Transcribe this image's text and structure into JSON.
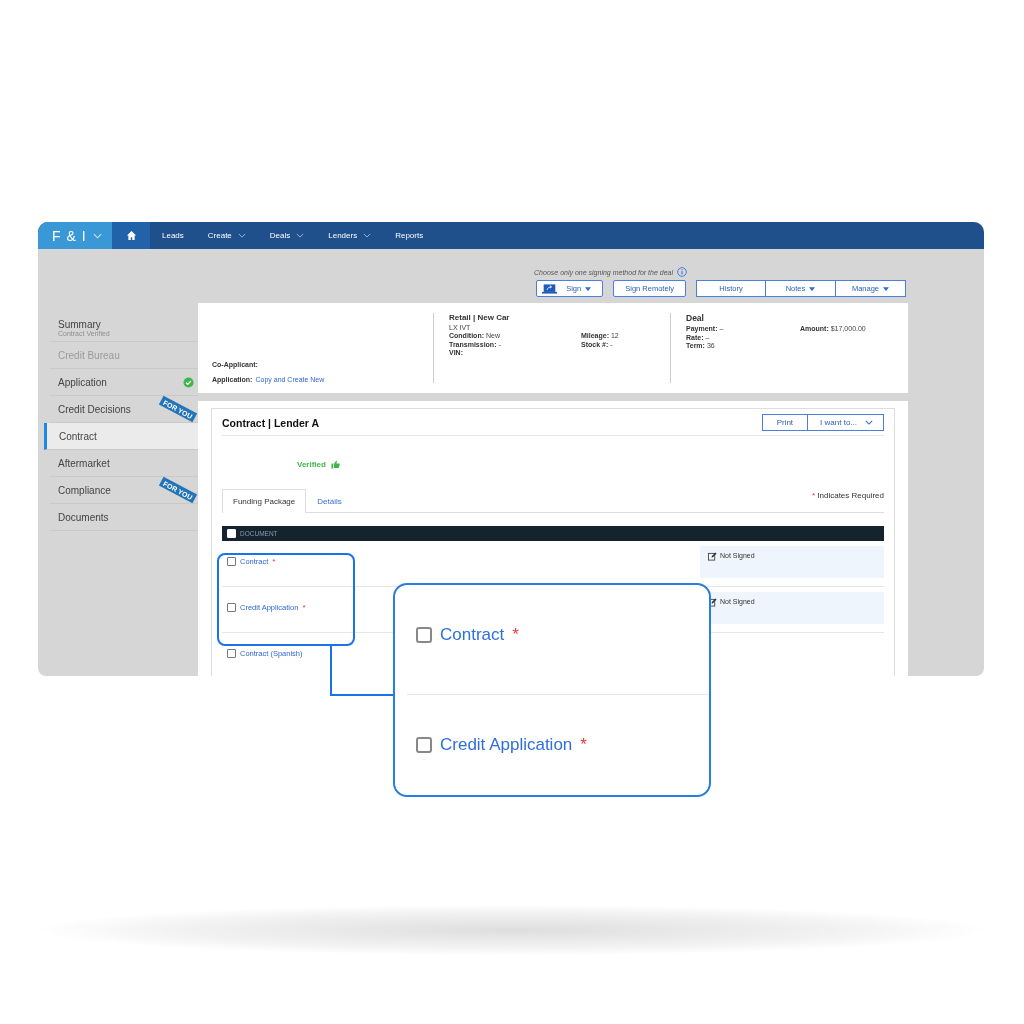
{
  "nav": {
    "brand": "F & I",
    "items": [
      {
        "label": "Leads",
        "dropdown": false
      },
      {
        "label": "Create",
        "dropdown": true
      },
      {
        "label": "Deals",
        "dropdown": true
      },
      {
        "label": "Lenders",
        "dropdown": true
      },
      {
        "label": "Reports",
        "dropdown": false
      }
    ]
  },
  "sidebar": {
    "items": [
      {
        "label": "Summary",
        "subtitle": "Contract Verified",
        "disabled": false,
        "done": false,
        "selected": false
      },
      {
        "label": "Credit Bureau",
        "disabled": true,
        "done": false,
        "selected": false
      },
      {
        "label": "Application",
        "disabled": false,
        "done": true,
        "selected": false
      },
      {
        "label": "Credit Decisions",
        "disabled": false,
        "done": false,
        "selected": false,
        "badge": "FOR YOU",
        "children": [
          {
            "label": "Contract",
            "disabled": false,
            "done": false,
            "selected": true
          }
        ]
      },
      {
        "label": "Aftermarket",
        "disabled": false,
        "done": false,
        "selected": false
      },
      {
        "label": "Compliance",
        "disabled": false,
        "done": false,
        "selected": false,
        "badge": "FOR YOU"
      },
      {
        "label": "Documents",
        "disabled": false,
        "done": false,
        "selected": false
      }
    ]
  },
  "signing": {
    "note": "Choose only one signing method for the deal",
    "sign_button": "Sign",
    "remote_button": "Sign Remotely",
    "menu_buttons": [
      {
        "label": "History",
        "dropdown": false
      },
      {
        "label": "Notes",
        "dropdown": true
      },
      {
        "label": "Manage",
        "dropdown": true
      }
    ]
  },
  "summary": {
    "co_applicant": "Co-Applicant:",
    "application_label": "Application:",
    "application_link": "Copy and Create New",
    "vehicle": {
      "title": "Retail | New Car",
      "model": "LX IVT",
      "fields": [
        {
          "label": "Condition:",
          "value": "New"
        },
        {
          "label": "Mileage:",
          "value": "12"
        },
        {
          "label": "Transmission:",
          "value": "-"
        },
        {
          "label": "Stock #:",
          "value": "-"
        },
        {
          "label": "VIN:"
        }
      ]
    },
    "deal": {
      "title": "Deal",
      "fields": [
        {
          "label": "Payment:",
          "value": "–"
        },
        {
          "label": "Amount:",
          "value": "$17,000.00"
        },
        {
          "label": "Rate:",
          "value": "–"
        },
        {
          "label": "Term:",
          "value": "36"
        }
      ]
    }
  },
  "contract": {
    "title": "Contract | Lender A",
    "print_button": "Print",
    "menu_button": "I want to...",
    "status": "Verified",
    "tabs": [
      {
        "label": "Funding Package",
        "selected": true
      },
      {
        "label": "Details",
        "selected": false
      }
    ],
    "required_note": "Indicates Required",
    "required_mark": "*",
    "table": {
      "column": "DOCUMENT",
      "all_checked": false,
      "rows": [
        {
          "name": "Contract",
          "required": true,
          "checked": false,
          "status": "Not Signed"
        },
        {
          "name": "Credit Application",
          "required": true,
          "checked": false,
          "status": "Not Signed"
        },
        {
          "name": "Contract (Spanish)",
          "required": false,
          "checked": false
        }
      ]
    }
  },
  "callout": {
    "rows": [
      {
        "name": "Contract",
        "required": true,
        "checked": false
      },
      {
        "name": "Credit Application",
        "required": true,
        "checked": false
      }
    ]
  }
}
